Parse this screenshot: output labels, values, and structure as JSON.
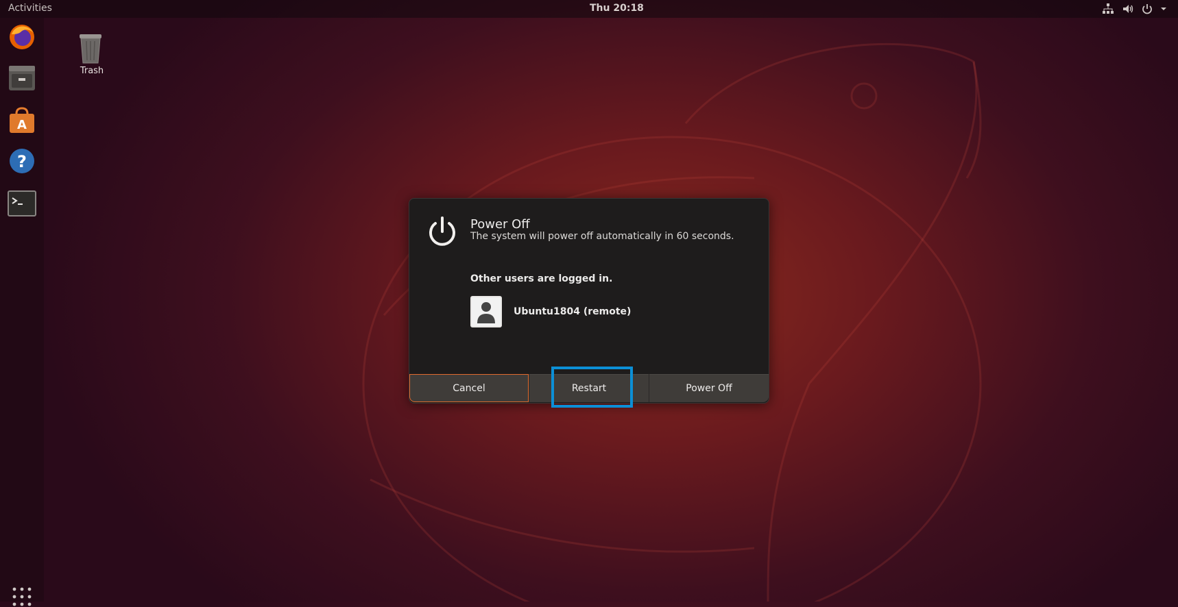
{
  "topbar": {
    "activities_label": "Activities",
    "clock": "Thu 20:18",
    "tray_icons": [
      "network-icon",
      "volume-icon",
      "power-icon",
      "chevron-down-icon"
    ]
  },
  "dock": {
    "apps": [
      "firefox-icon",
      "files-icon",
      "software-center-icon",
      "help-icon",
      "terminal-icon"
    ],
    "show_apps_icon": "grid-icon"
  },
  "desktop": {
    "trash_label": "Trash"
  },
  "dialog": {
    "title": "Power Off",
    "subtitle": "The system will power off automatically in 60 seconds.",
    "users_heading": "Other users are logged in.",
    "user_name": "Ubuntu1804 (remote)",
    "buttons": {
      "cancel": "Cancel",
      "restart": "Restart",
      "power_off": "Power Off"
    }
  },
  "colors": {
    "dialog_bg": "#1e1c1c",
    "button_bg": "#3f3c39",
    "focus_border": "#e06a2e",
    "highlight": "#0c8fd6"
  }
}
